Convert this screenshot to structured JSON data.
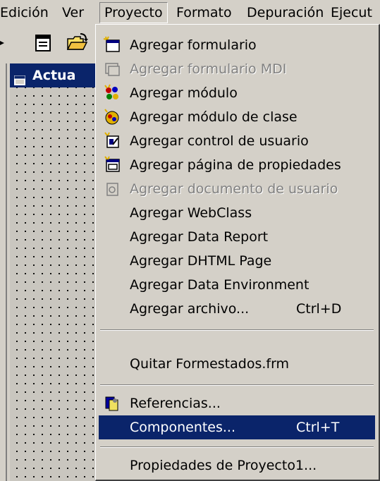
{
  "menubar": {
    "items": [
      {
        "label": "Edición"
      },
      {
        "label": "Ver"
      },
      {
        "label": "Proyecto"
      },
      {
        "label": "Formato"
      },
      {
        "label": "Depuración"
      },
      {
        "label": "Ejecut"
      }
    ]
  },
  "designer": {
    "title": "Actua"
  },
  "menu": {
    "items": [
      {
        "label": "Agregar formulario",
        "shortcut": "",
        "icon": "form-icon",
        "state": "enabled"
      },
      {
        "label": "Agregar formulario MDI",
        "shortcut": "",
        "icon": "mdi-form-icon",
        "state": "disabled"
      },
      {
        "label": "Agregar módulo",
        "shortcut": "",
        "icon": "module-icon",
        "state": "enabled"
      },
      {
        "label": "Agregar módulo de clase",
        "shortcut": "",
        "icon": "class-module-icon",
        "state": "enabled"
      },
      {
        "label": "Agregar control de usuario",
        "shortcut": "",
        "icon": "user-control-icon",
        "state": "enabled"
      },
      {
        "label": "Agregar página de propiedades",
        "shortcut": "",
        "icon": "property-page-icon",
        "state": "enabled"
      },
      {
        "label": "Agregar documento de usuario",
        "shortcut": "",
        "icon": "user-document-icon",
        "state": "disabled"
      },
      {
        "label": "Agregar WebClass",
        "shortcut": "",
        "icon": "",
        "state": "enabled"
      },
      {
        "label": "Agregar Data Report",
        "shortcut": "",
        "icon": "",
        "state": "enabled"
      },
      {
        "label": "Agregar DHTML Page",
        "shortcut": "",
        "icon": "",
        "state": "enabled"
      },
      {
        "label": "Agregar Data Environment",
        "shortcut": "",
        "icon": "",
        "state": "enabled"
      },
      {
        "label": "Agregar archivo...",
        "shortcut": "Ctrl+D",
        "icon": "",
        "state": "enabled"
      },
      {
        "label": "Quitar Formestados.frm",
        "shortcut": "",
        "icon": "",
        "state": "enabled"
      },
      {
        "label": "Referencias...",
        "shortcut": "",
        "icon": "references-icon",
        "state": "enabled"
      },
      {
        "label": "Componentes...",
        "shortcut": "Ctrl+T",
        "icon": "",
        "state": "selected"
      },
      {
        "label": "Propiedades de Proyecto1...",
        "shortcut": "",
        "icon": "",
        "state": "enabled"
      }
    ]
  },
  "colors": {
    "selection": "#0a246a",
    "face": "#d4d0c8",
    "disabled_text": "#808080"
  }
}
